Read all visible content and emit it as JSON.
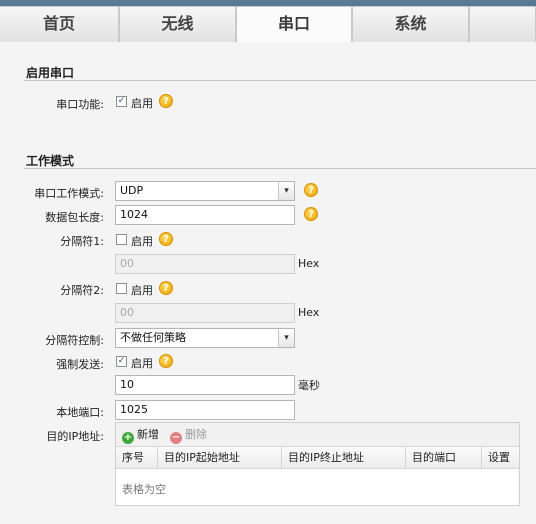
{
  "tabs": [
    {
      "label": "首页"
    },
    {
      "label": "无线"
    },
    {
      "label": "串口"
    },
    {
      "label": "系统"
    }
  ],
  "section_serial": {
    "title": "启用串口",
    "serial_function_label": "串口功能:",
    "enable_label": "启用",
    "enabled": true
  },
  "section_mode": {
    "title": "工作模式",
    "work_mode": {
      "label": "串口工作模式:",
      "value": "UDP"
    },
    "packet_length": {
      "label": "数据包长度:",
      "value": "1024"
    },
    "delimiter1": {
      "label": "分隔符1:",
      "enable_label": "启用",
      "enabled": false,
      "value": "00",
      "unit": "Hex"
    },
    "delimiter2": {
      "label": "分隔符2:",
      "enable_label": "启用",
      "enabled": false,
      "value": "00",
      "unit": "Hex"
    },
    "delimiter_control": {
      "label": "分隔符控制:",
      "value": "不做任何策略"
    },
    "force_send": {
      "label": "强制发送:",
      "enable_label": "启用",
      "enabled": true,
      "value": "10",
      "unit": "毫秒"
    },
    "local_port": {
      "label": "本地端口:",
      "value": "1025"
    },
    "dest_ip": {
      "label": "目的IP地址:",
      "add_label": "新增",
      "delete_label": "删除",
      "columns": [
        "序号",
        "目的IP起始地址",
        "目的IP终止地址",
        "目的端口",
        "设置"
      ],
      "empty_text": "表格为空"
    }
  },
  "check_mark": "✓",
  "help_glyph": "?",
  "colors": {
    "topbar": "#4b6d8a",
    "help": "#f0a400",
    "add": "#3ea83a",
    "delete": "#e08080"
  }
}
